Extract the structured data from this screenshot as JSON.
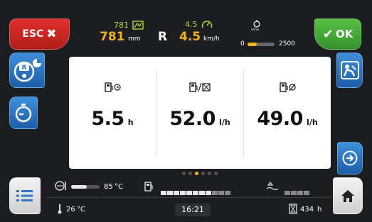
{
  "buttons": {
    "esc_label": "ESC",
    "ok_label": "OK"
  },
  "top": {
    "sp_top": "781",
    "sp_value": "781",
    "sp_unit": "mm",
    "gear": "R",
    "speed_top": "4.5",
    "speed_value": "4.5",
    "speed_unit": "km/h",
    "rpm_icon_label": "n/min",
    "rpm_min": "0",
    "rpm_max": "2500",
    "rpm_fraction": 0.35
  },
  "panel": {
    "columns": [
      {
        "icon": "fuel-time-icon",
        "value": "5.5",
        "unit": "h"
      },
      {
        "icon": "fuel-rate-icon",
        "value": "52.0",
        "unit": "l/h"
      },
      {
        "icon": "fuel-average-icon",
        "value": "49.0",
        "unit": "l/h"
      }
    ],
    "page_count": 6,
    "active_page": 3
  },
  "bottom": {
    "coolant_value": "85",
    "coolant_unit": "°C",
    "coolant_fraction": 0.55,
    "fuel_level_segments_total": 11,
    "fuel_level_segments_on": 8,
    "adblue_segments_total": 4,
    "adblue_segments_on": 0,
    "outside_temp": "26",
    "outside_temp_unit": "°C",
    "time": "16:21",
    "hours": "434",
    "hours_unit": "h"
  },
  "colors": {
    "accent_green": "#b6d23a",
    "esc_red": "#d42a27",
    "ok_green": "#4aad3a",
    "button_blue": "#2e78c6",
    "page_dot_active": "#f2b31a"
  }
}
